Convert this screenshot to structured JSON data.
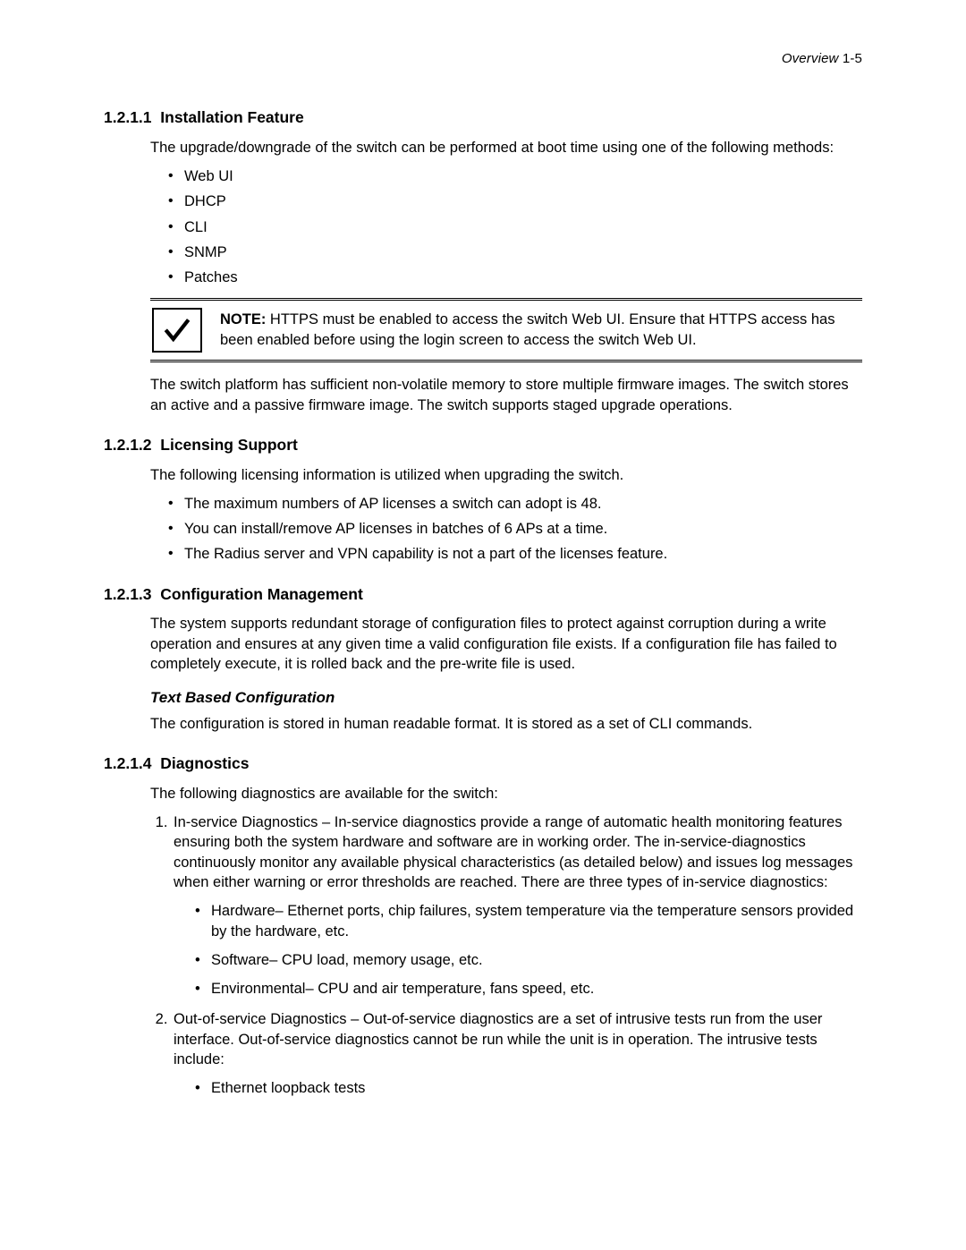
{
  "runningHead": {
    "italic": "Overview",
    "plain": "  1-5"
  },
  "s1": {
    "num": "1.2.1.1",
    "title": "Installation Feature",
    "intro": "The upgrade/downgrade of the switch can be performed at boot time using one of the following methods:",
    "bullets": [
      "Web UI",
      "DHCP",
      "CLI",
      "SNMP",
      "Patches"
    ],
    "noteLabel": "NOTE:",
    "noteText": " HTTPS must be enabled to access the switch Web UI. Ensure that HTTPS access has been enabled before using the login screen to access the switch Web UI.",
    "after": "The switch platform has sufficient non-volatile memory to store multiple firmware images. The switch stores an active and a passive firmware image. The switch supports staged upgrade operations."
  },
  "s2": {
    "num": "1.2.1.2",
    "title": "Licensing Support",
    "intro": "The following licensing information is utilized when upgrading the switch.",
    "bullets": [
      "The maximum numbers of AP licenses a switch can adopt is 48.",
      "You can install/remove AP licenses in batches of 6 APs at a time.",
      "The Radius server and VPN capability is not a part of the licenses feature."
    ]
  },
  "s3": {
    "num": "1.2.1.3",
    "title": "Configuration Management",
    "para": "The system supports redundant storage of configuration files to protect against corruption during a write operation and ensures at any given time a valid configuration file exists. If a configuration file has failed to completely execute, it is rolled back and the pre-write file is used.",
    "subTitle": "Text Based Configuration",
    "subPara": "The configuration is stored in human readable format. It is stored as a set of CLI commands."
  },
  "s4": {
    "num": "1.2.1.4",
    "title": "Diagnostics",
    "intro": "The following diagnostics are available for the switch:",
    "item1": "In-service Diagnostics – In-service diagnostics provide a range of automatic health monitoring features ensuring both the system hardware and software are in working order. The in-service-diagnostics continuously monitor any available physical characteristics (as detailed below) and issues log messages when either warning or error thresholds are reached. There are three types of in-service diagnostics:",
    "item1bullets": [
      "Hardware– Ethernet ports, chip failures, system temperature via the temperature sensors provided by the hardware, etc.",
      "Software– CPU load, memory usage, etc.",
      "Environmental– CPU and air temperature, fans speed, etc."
    ],
    "item2": "Out-of-service Diagnostics – Out-of-service diagnostics are a set of intrusive tests run from the user interface. Out-of-service diagnostics cannot be run while the unit is in operation. The intrusive tests include:",
    "item2bullets": [
      "Ethernet loopback tests"
    ]
  }
}
